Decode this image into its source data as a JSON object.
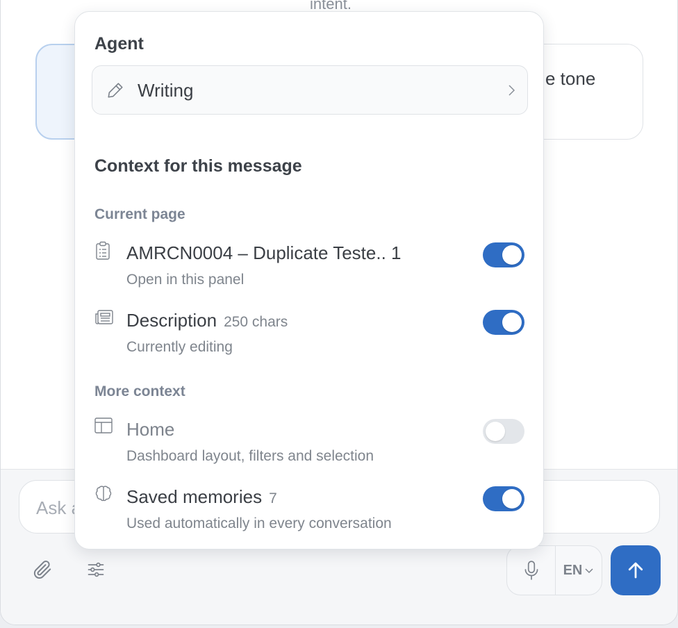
{
  "background": {
    "intent_text": "intent.",
    "suggestion_right": "e tone"
  },
  "composer": {
    "placeholder": "Ask a",
    "language": "EN"
  },
  "popover": {
    "agent_title": "Agent",
    "agent_value": "Writing",
    "context_title": "Context for this message",
    "groups": {
      "current_page": "Current page",
      "more_context": "More context"
    },
    "items": [
      {
        "name": "AMRCN0004 – Duplicate Teste.. 1",
        "meta": "",
        "sub": "Open in this panel",
        "enabled": true
      },
      {
        "name": "Description",
        "meta": "250 chars",
        "sub": "Currently editing",
        "enabled": true
      },
      {
        "name": "Home",
        "meta": "",
        "sub": "Dashboard layout, filters and selection",
        "enabled": false
      },
      {
        "name": "Saved memories",
        "meta": "7",
        "sub": "Used automatically in every conversation",
        "enabled": true
      }
    ]
  },
  "colors": {
    "accent": "#2f6dc4",
    "toggle_off": "#e3e6ea"
  }
}
